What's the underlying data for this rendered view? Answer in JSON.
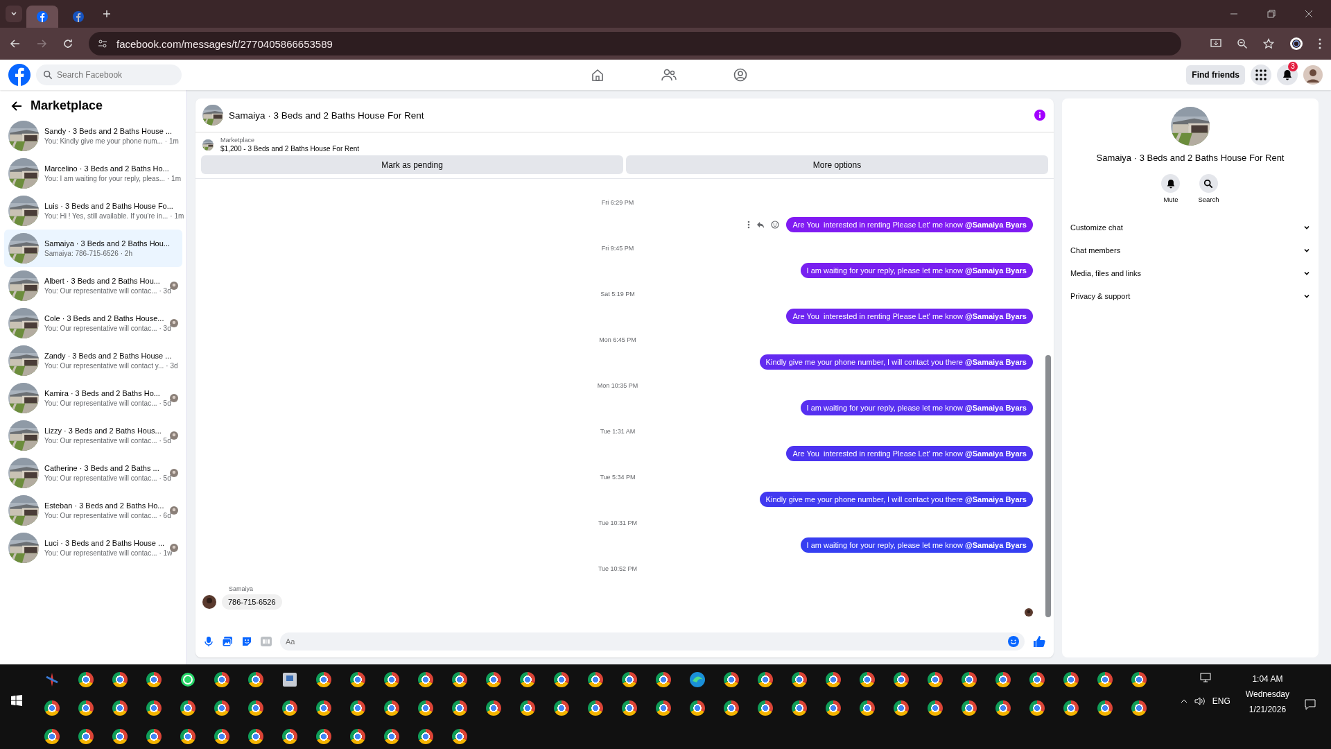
{
  "browser": {
    "tabs": [
      {
        "selected": true
      },
      {
        "selected": false
      }
    ],
    "url": "facebook.com/messages/t/2770405866653589"
  },
  "header": {
    "search_placeholder": "Search Facebook",
    "find_friends": "Find friends",
    "notification_count": "3"
  },
  "sidebar": {
    "title": "Marketplace",
    "items": [
      {
        "title": "Sandy · 3 Beds and 2 Baths House ...",
        "preview": "You: Kindly give me your phone num...",
        "time": "· 1m",
        "selected": false,
        "seen": false
      },
      {
        "title": "Marcelino · 3 Beds and 2 Baths Ho...",
        "preview": "You: I am waiting for your reply, pleas...",
        "time": "· 1m",
        "selected": false,
        "seen": false
      },
      {
        "title": "Luis · 3 Beds and 2 Baths House Fo...",
        "preview": "You: Hi ! Yes, still available. If you're in...",
        "time": "· 1m",
        "selected": false,
        "seen": false
      },
      {
        "title": "Samaiya · 3 Beds and 2 Baths Hou...",
        "preview": "Samaiya: 786-715-6526",
        "time": "· 2h",
        "selected": true,
        "seen": false
      },
      {
        "title": "Albert · 3 Beds and 2 Baths Hou...",
        "preview": "You: Our representative will contac...",
        "time": "· 3d",
        "selected": false,
        "seen": true
      },
      {
        "title": "Cole · 3 Beds and 2 Baths House...",
        "preview": "You: Our representative will contac...",
        "time": "· 3d",
        "selected": false,
        "seen": true
      },
      {
        "title": "Zandy · 3 Beds and 2 Baths House ...",
        "preview": "You: Our representative will contact y...",
        "time": "· 3d",
        "selected": false,
        "seen": false
      },
      {
        "title": "Kamira · 3 Beds and 2 Baths Ho...",
        "preview": "You: Our representative will contac...",
        "time": "· 5d",
        "selected": false,
        "seen": true
      },
      {
        "title": "Lizzy · 3 Beds and 2 Baths Hous...",
        "preview": "You: Our representative will contac...",
        "time": "· 5d",
        "selected": false,
        "seen": true
      },
      {
        "title": "Catherine · 3 Beds and 2 Baths ...",
        "preview": "You: Our representative will contac...",
        "time": "· 5d",
        "selected": false,
        "seen": true
      },
      {
        "title": "Esteban · 3 Beds and 2 Baths Ho...",
        "preview": "You: Our representative will contac...",
        "time": "· 6d",
        "selected": false,
        "seen": true
      },
      {
        "title": "Luci · 3 Beds and 2 Baths House ...",
        "preview": "You: Our representative will contac...",
        "time": "· 1w",
        "selected": false,
        "seen": true
      }
    ]
  },
  "chat": {
    "title": "Samaiya · 3 Beds and 2 Baths House For Rent",
    "listing": {
      "label": "Marketplace",
      "text": "$1,200 - 3 Beds and 2 Baths House For Rent"
    },
    "actions": [
      "Mark as pending",
      "More options"
    ],
    "messages": [
      {
        "kind": "time",
        "text": "Fri 6:29 PM"
      },
      {
        "kind": "out",
        "text": "Are You  interested in renting Please Let' me know **@Samaiya Byars**",
        "actions_shown": true
      },
      {
        "kind": "time",
        "text": "Fri 9:45 PM"
      },
      {
        "kind": "out",
        "text": "I am waiting for your reply, please let me know **@Samaiya Byars**",
        "actions_shown": false
      },
      {
        "kind": "time",
        "text": "Sat 5:19 PM"
      },
      {
        "kind": "out",
        "text": "Are You  interested in renting Please Let' me know **@Samaiya Byars**",
        "actions_shown": false
      },
      {
        "kind": "time",
        "text": "Mon 6:45 PM"
      },
      {
        "kind": "out",
        "text": "Kindly give me your phone number, I will contact you there **@Samaiya Byars**",
        "actions_shown": false
      },
      {
        "kind": "time",
        "text": "Mon 10:35 PM"
      },
      {
        "kind": "out",
        "text": "I am waiting for your reply, please let me know **@Samaiya Byars**",
        "actions_shown": false
      },
      {
        "kind": "time",
        "text": "Tue 1:31 AM"
      },
      {
        "kind": "out",
        "text": "Are You  interested in renting Please Let' me know **@Samaiya Byars**",
        "actions_shown": false
      },
      {
        "kind": "time",
        "text": "Tue 5:34 PM"
      },
      {
        "kind": "out",
        "text": "Kindly give me your phone number, I will contact you there **@Samaiya Byars**",
        "actions_shown": false
      },
      {
        "kind": "time",
        "text": "Tue 10:31 PM"
      },
      {
        "kind": "out",
        "text": "I am waiting for your reply, please let me know **@Samaiya Byars**",
        "actions_shown": false
      },
      {
        "kind": "time",
        "text": "Tue 10:52 PM"
      },
      {
        "kind": "in",
        "sender": "Samaiya",
        "text": "786-715-6526"
      }
    ],
    "composer": {
      "placeholder": "Aa"
    }
  },
  "details": {
    "title": "Samaiya · 3 Beds and 2 Baths House For Rent",
    "buttons": [
      {
        "kind": "mute",
        "label": "Mute"
      },
      {
        "kind": "search",
        "label": "Search"
      }
    ],
    "sections": [
      "Customize chat",
      "Chat members",
      "Media, files and links",
      "Privacy & support"
    ]
  },
  "taskbar": {
    "language": "ENG",
    "time": "1:04 AM",
    "day": "Wednesday",
    "date": "1/21/2026"
  }
}
